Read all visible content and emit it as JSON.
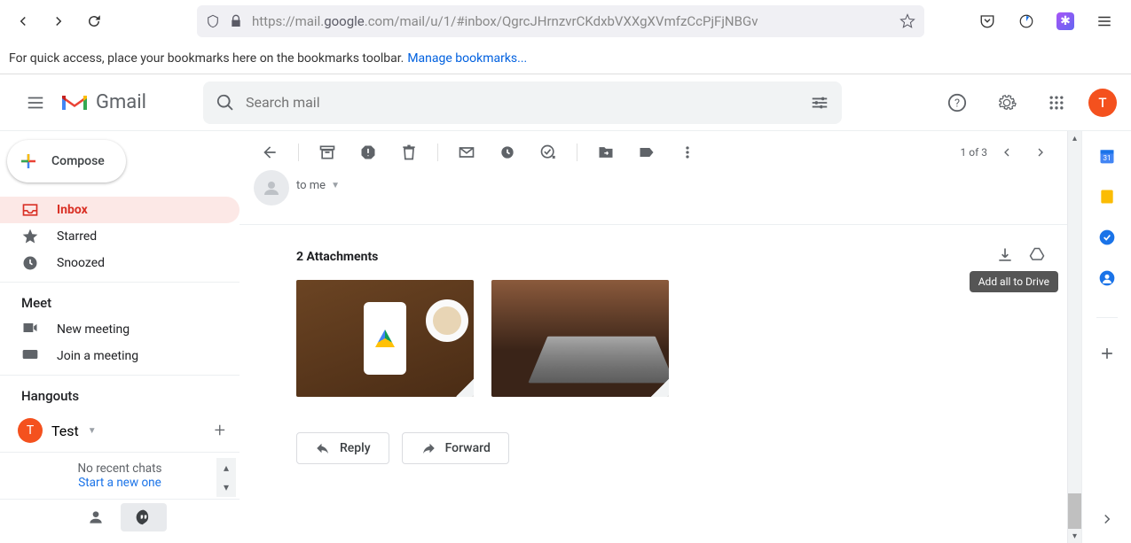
{
  "browser": {
    "url_pre": "https://mail.",
    "url_host": "google",
    "url_post": ".com/mail/u/1/#inbox/QgrcJHrnzvrCKdxbVXXgXVmfzCcPjFjNBGv"
  },
  "bookmark_hint": {
    "text": "For quick access, place your bookmarks here on the bookmarks toolbar.",
    "link": "Manage bookmarks..."
  },
  "gmail": {
    "logo_text": "Gmail",
    "search_placeholder": "Search mail",
    "avatar_letter": "T"
  },
  "compose": "Compose",
  "nav": {
    "inbox": "Inbox",
    "starred": "Starred",
    "snoozed": "Snoozed"
  },
  "meet": {
    "heading": "Meet",
    "new_meeting": "New meeting",
    "join_meeting": "Join a meeting"
  },
  "hangouts": {
    "heading": "Hangouts",
    "user": "Test",
    "no_chats": "No recent chats",
    "start_new": "Start a new one"
  },
  "toolbar": {
    "pager": "1 of 3"
  },
  "message": {
    "to_line": "to me"
  },
  "attachments": {
    "title": "2 Attachments",
    "tooltip": "Add all to Drive"
  },
  "actions": {
    "reply": "Reply",
    "forward": "Forward"
  }
}
